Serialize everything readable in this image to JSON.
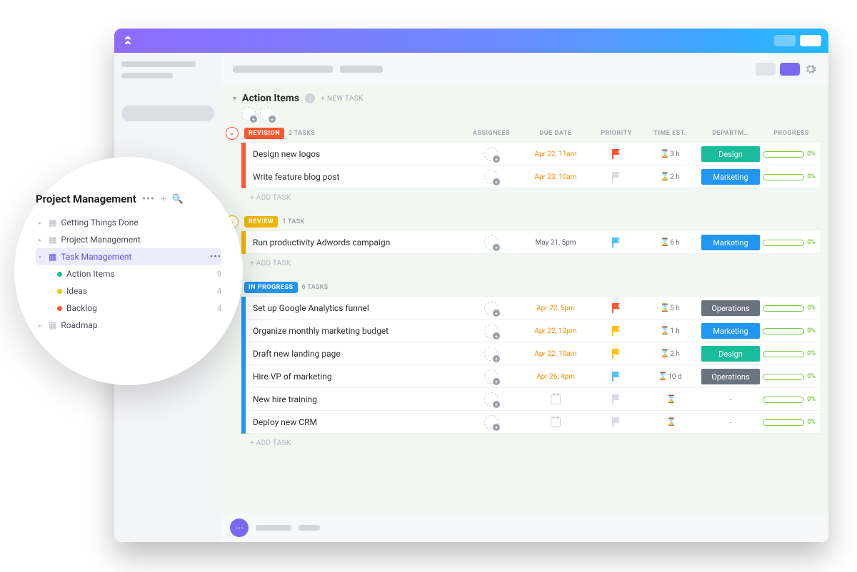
{
  "list": {
    "title": "Action Items",
    "new_task": "+ NEW TASK",
    "add_task": "+ ADD TASK"
  },
  "columns": {
    "assignees": "ASSIGNEES",
    "due": "DUE DATE",
    "priority": "PRIORITY",
    "time": "TIME EST.",
    "dept": "DEPARTM…",
    "progress": "PROGRESS"
  },
  "groups": [
    {
      "name": "REVISION",
      "color": "red",
      "count": "2 TASKS",
      "tasks": [
        {
          "name": "Design new logos",
          "due": "Apr 22, 11am",
          "due_cls": "due-orange",
          "flag": "red",
          "time": "3 h",
          "dept": "Design",
          "dept_cls": "design",
          "pct": "0%"
        },
        {
          "name": "Write feature blog post",
          "due": "Apr 23, 10am",
          "due_cls": "due-orange",
          "flag": "grey",
          "time": "2 h",
          "dept": "Marketing",
          "dept_cls": "marketing",
          "pct": "0%"
        }
      ]
    },
    {
      "name": "REVIEW",
      "color": "yellow",
      "count": "1 TASK",
      "tasks": [
        {
          "name": "Run productivity Adwords campaign",
          "due": "May 31, 5pm",
          "due_cls": "due-norm",
          "flag": "blue",
          "time": "6 h",
          "dept": "Marketing",
          "dept_cls": "marketing",
          "pct": "0%"
        }
      ]
    },
    {
      "name": "IN PROGRESS",
      "color": "blue",
      "count": "6 TASKS",
      "tasks": [
        {
          "name": "Set up Google Analytics funnel",
          "due": "Apr 22, 5pm",
          "due_cls": "due-orange",
          "flag": "red",
          "time": "5 h",
          "dept": "Operations",
          "dept_cls": "operations",
          "pct": "0%"
        },
        {
          "name": "Organize monthly marketing budget",
          "due": "Apr 22, 12pm",
          "due_cls": "due-orange",
          "flag": "yellow",
          "time": "1 h",
          "dept": "Marketing",
          "dept_cls": "marketing",
          "pct": "0%"
        },
        {
          "name": "Draft new landing page",
          "due": "Apr 22, 10am",
          "due_cls": "due-orange",
          "flag": "yellow",
          "time": "2 h",
          "dept": "Design",
          "dept_cls": "design",
          "pct": "0%"
        },
        {
          "name": "Hire VP of marketing",
          "due": "Apr 26, 4pm",
          "due_cls": "due-orange",
          "flag": "blue",
          "time": "10 d",
          "dept": "Operations",
          "dept_cls": "operations",
          "pct": "0%"
        },
        {
          "name": "New hire training",
          "due": "",
          "due_cls": "",
          "flag": "grey",
          "time": "",
          "dept": "-",
          "dept_cls": "blank",
          "pct": "0%"
        },
        {
          "name": "Deploy new CRM",
          "due": "",
          "due_cls": "",
          "flag": "grey",
          "time": "",
          "dept": "-",
          "dept_cls": "blank",
          "pct": "0%"
        }
      ]
    }
  ],
  "popover": {
    "title": "Project Management",
    "items": [
      {
        "kind": "folder",
        "tri": "closed",
        "name": "Getting Things Done"
      },
      {
        "kind": "folder",
        "tri": "closed",
        "name": "Project Management"
      },
      {
        "kind": "folder",
        "tri": "open",
        "name": "Task Management",
        "active": true
      },
      {
        "kind": "child",
        "dot": "green",
        "name": "Action Items",
        "count": "9"
      },
      {
        "kind": "child",
        "dot": "yellow",
        "name": "Ideas",
        "count": "4"
      },
      {
        "kind": "child",
        "dot": "red",
        "name": "Backlog",
        "count": "4"
      },
      {
        "kind": "folder",
        "tri": "closed",
        "name": "Roadmap"
      }
    ]
  }
}
